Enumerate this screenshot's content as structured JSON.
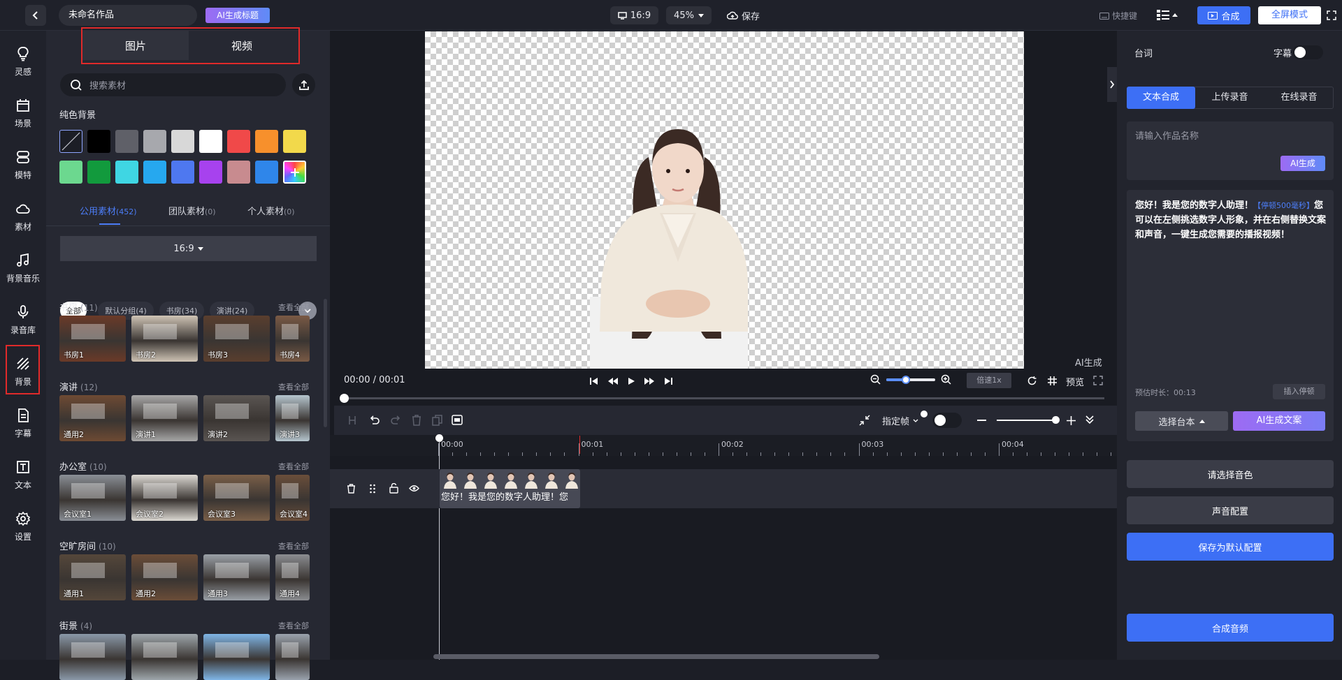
{
  "topbar": {
    "project_name": "未命名作品",
    "ai_title_button": "AI生成标题",
    "ratio": "16:9",
    "zoom": "45%",
    "save": "保存",
    "shortcuts": "快捷键",
    "compose": "合成",
    "fullscreen": "全屏模式"
  },
  "rail": {
    "items": [
      {
        "label": "灵感",
        "icon": "lightbulb-icon"
      },
      {
        "label": "场景",
        "icon": "scene-icon"
      },
      {
        "label": "模特",
        "icon": "model-icon"
      },
      {
        "label": "素材",
        "icon": "cloud-icon"
      },
      {
        "label": "背景音乐",
        "icon": "music-icon"
      },
      {
        "label": "录音库",
        "icon": "microphone-icon"
      },
      {
        "label": "背景",
        "icon": "background-icon"
      },
      {
        "label": "字幕",
        "icon": "subtitle-icon"
      },
      {
        "label": "文本",
        "icon": "text-icon"
      },
      {
        "label": "设置",
        "icon": "gear-icon"
      }
    ]
  },
  "panel": {
    "tabs": [
      "图片",
      "视频"
    ],
    "search_placeholder": "搜索素材",
    "solid_bg_title": "纯色背景",
    "colors_row1": [
      "#1c1e26",
      "#000000",
      "#5f6068",
      "#a7a8ad",
      "#d8d8d8",
      "#ffffff",
      "#f04949",
      "#f7902c",
      "#f2d94b"
    ],
    "colors_row2": [
      "#6cd88f",
      "#129a3d",
      "#3fd6e3",
      "#26a8ef",
      "#4e78f0",
      "#a742ee",
      "#c88b8f",
      "#2f86ea"
    ],
    "source_tabs": [
      {
        "label": "公用素材",
        "count": "(452)"
      },
      {
        "label": "团队素材",
        "count": "(0)"
      },
      {
        "label": "个人素材",
        "count": "(0)"
      }
    ],
    "ratio_select": "16:9",
    "chips": [
      "全部",
      "默认分组(4)",
      "书房(34)",
      "演讲(24)"
    ],
    "see_all": "查看全部",
    "sections": [
      {
        "title": "书房",
        "count": "(11)",
        "items": [
          "书房1",
          "书房2",
          "书房3",
          "书房4"
        ]
      },
      {
        "title": "演讲",
        "count": "(12)",
        "items": [
          "通用2",
          "演讲1",
          "演讲2",
          "演讲3"
        ]
      },
      {
        "title": "办公室",
        "count": "(10)",
        "items": [
          "会议室1",
          "会议室2",
          "会议室3",
          "会议室4"
        ]
      },
      {
        "title": "空旷房间",
        "count": "(10)",
        "items": [
          "通用1",
          "通用2",
          "通用3",
          "通用4"
        ]
      },
      {
        "title": "街景",
        "count": "(4)",
        "items": [
          "",
          "",
          "",
          ""
        ]
      }
    ]
  },
  "preview": {
    "watermark": "AI生成",
    "time": "00:00 / 00:01",
    "speed": "倍速1x",
    "preview_label": "预览"
  },
  "timeline": {
    "keyframe_label": "指定帧",
    "ticks": [
      "00:00",
      "00:01",
      "00:02",
      "00:03",
      "00:04"
    ],
    "clip_text": "您好！我是您的数字人助理！您"
  },
  "right": {
    "title": "台词",
    "subtitle_toggle": "字幕",
    "tabs": [
      "文本合成",
      "上传录音",
      "在线录音"
    ],
    "name_placeholder": "请输入作品名称",
    "ai_gen": "AI生成",
    "script_line1": "您好！我是您的数字人助理！",
    "pause_tag": "【停顿500毫秒】",
    "script_rest": "您可以在左侧挑选数字人形象，并在右侧替换文案和声音，一键生成您需要的播报视频！",
    "duration": "预估时长：00:13",
    "insert_pause": "插入停顿",
    "choose_script": "选择台本",
    "ai_copy": "AI生成文案",
    "choose_voice": "请选择音色",
    "voice_config": "声音配置",
    "save_default": "保存为默认配置",
    "compose_audio": "合成音频"
  },
  "colors": {
    "accent": "#3d6ff5",
    "highlight_red": "#e02a2a",
    "purple": "#8b5cf6"
  }
}
